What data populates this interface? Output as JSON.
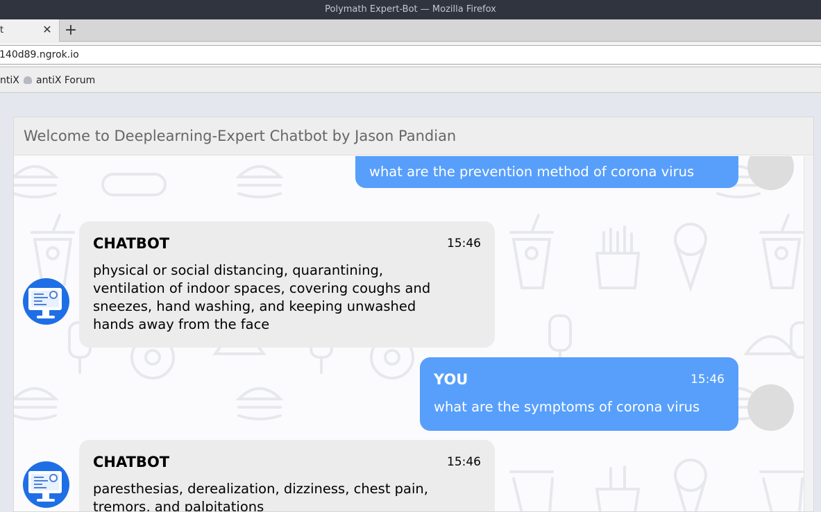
{
  "browser": {
    "window_title": "Polymath Expert-Bot — Mozilla Firefox",
    "tab_title": "t",
    "tab_close": "✕",
    "new_tab": "+",
    "url": "140d89.ngrok.io",
    "bookmarks": [
      "ntiX",
      "antiX Forum"
    ]
  },
  "chat": {
    "header_title": "Welcome to Deeplearning-Expert Chatbot by Jason Pandian",
    "messages": [
      {
        "sender": "user",
        "name": "",
        "time": "",
        "text": "what are the prevention method of corona virus"
      },
      {
        "sender": "bot",
        "name": "CHATBOT",
        "time": "15:46",
        "text_lines": [
          "physical or social distancing, quarantining,",
          "ventilation of indoor spaces, covering coughs and",
          "sneezes, hand washing, and keeping unwashed",
          "hands away from the face"
        ]
      },
      {
        "sender": "user",
        "name": "YOU",
        "time": "15:46",
        "text": "what are the symptoms of corona virus"
      },
      {
        "sender": "bot",
        "name": "CHATBOT",
        "time": "15:46",
        "text_lines": [
          "paresthesias, derealization, dizziness, chest pain,",
          "tremors, and palpitations"
        ]
      }
    ]
  },
  "colors": {
    "user_bubble": "#579ffb",
    "bot_bubble": "#ececec",
    "titlebar": "#2f343f",
    "bot_avatar": "#1e6fe6"
  },
  "icons": {
    "bot_avatar": "robot-monitor-icon",
    "user_avatar": "user-avatar-placeholder",
    "bookmark": "antix-favicon-icon"
  }
}
